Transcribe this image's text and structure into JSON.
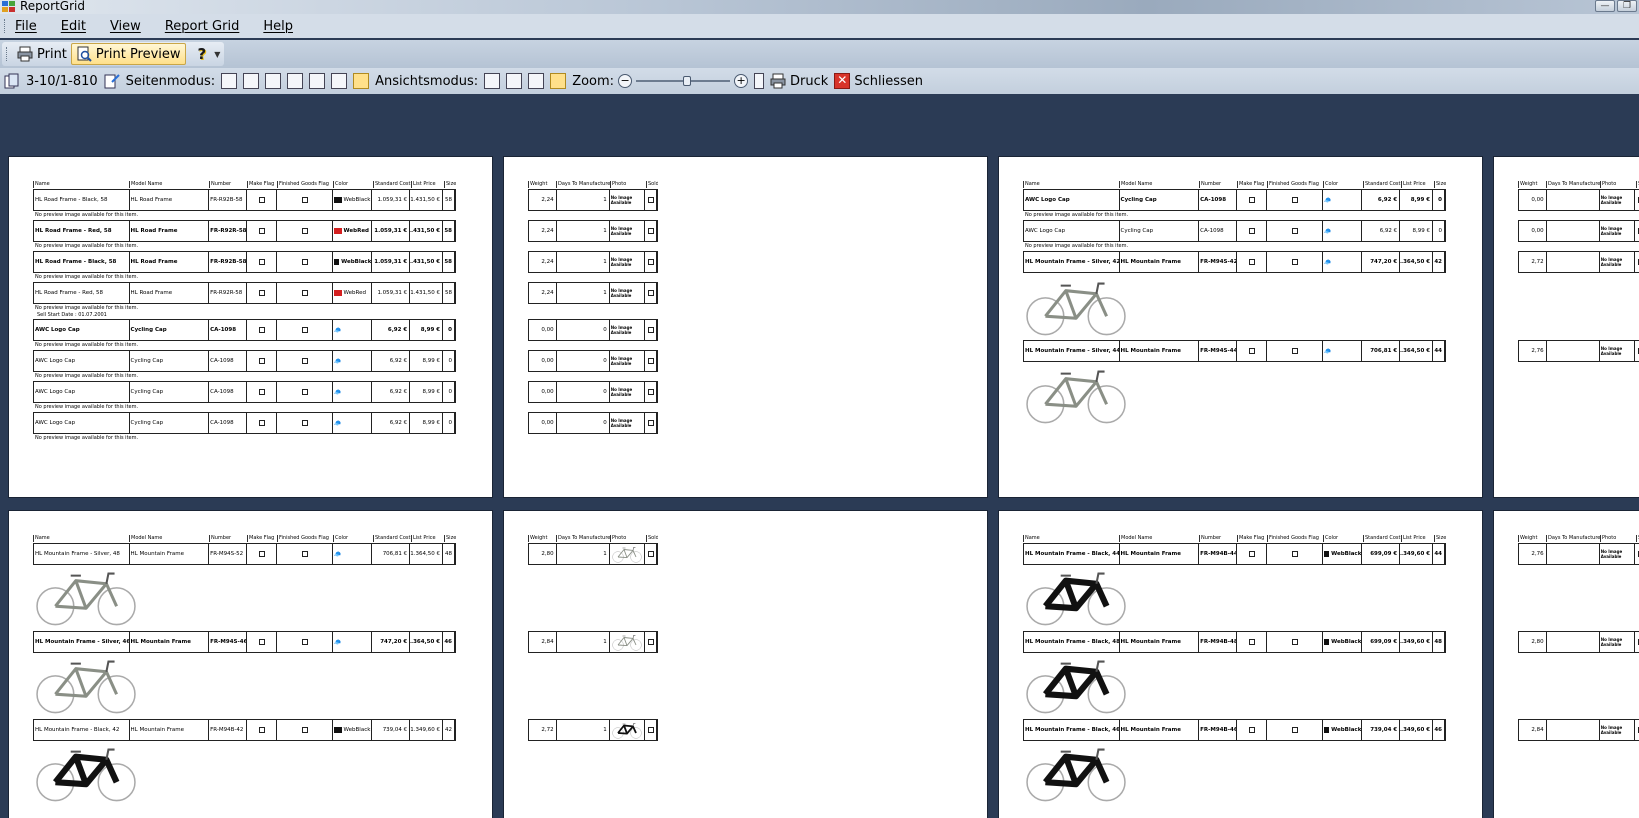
{
  "window": {
    "title": "ReportGrid",
    "minimize": "—",
    "maximize": "❐"
  },
  "menu": [
    "File",
    "Edit",
    "View",
    "Report Grid",
    "Help"
  ],
  "toolbar1": {
    "print": "Print",
    "print_preview": "Print Preview",
    "help_icon": "?"
  },
  "toolbar2": {
    "page_range": "3-10/1-810",
    "page_mode_label": "Seitenmodus:",
    "view_mode_label": "Ansichtsmodus:",
    "zoom_label": "Zoom:",
    "zoom_minus": "−",
    "zoom_plus": "+",
    "zoom_level": 0.55,
    "print_label": "Druck",
    "close_label": "Schliessen"
  },
  "report": {
    "headers_main": [
      "Name",
      "Model Name",
      "Number",
      "Make Flag",
      "Finished Goods Flag",
      "Color",
      "Standard Cost",
      "List Price",
      "Size"
    ],
    "headers_side": [
      "Weight",
      "Days To Manufacture",
      "Photo",
      "Sold"
    ],
    "no_preview": "No preview image available for this item.",
    "sell_start": "Sell Start Date : 01.07.2001",
    "no_image": "No Image Available",
    "page1_rows": [
      [
        "HL Road Frame - Black, 58",
        "HL Road Frame",
        "FR-R92B-58",
        "WebBlack",
        "1.059,31 €",
        "1.431,50 €",
        "58"
      ],
      [
        "HL Road Frame - Red, 58",
        "HL Road Frame",
        "FR-R92R-58",
        "WebRed",
        "1.059,31 €",
        "1.431,50 €",
        "58"
      ],
      [
        "HL Road Frame - Black, 58",
        "HL Road Frame",
        "FR-R92B-58",
        "WebBlack",
        "1.059,31 €",
        "1.431,50 €",
        "58"
      ],
      [
        "HL Road Frame - Red, 58",
        "HL Road Frame",
        "FR-R92R-58",
        "WebRed",
        "1.059,31 €",
        "1.431,50 €",
        "58"
      ],
      [
        "AWC Logo Cap",
        "Cycling Cap",
        "CA-1098",
        "",
        "6,92 €",
        "8,99 €",
        "0"
      ],
      [
        "AWC Logo Cap",
        "Cycling Cap",
        "CA-1098",
        "",
        "6,92 €",
        "8,99 €",
        "0"
      ],
      [
        "AWC Logo Cap",
        "Cycling Cap",
        "CA-1098",
        "",
        "6,92 €",
        "8,99 €",
        "0"
      ],
      [
        "AWC Logo Cap",
        "Cycling Cap",
        "CA-1098",
        "",
        "6,92 €",
        "8,99 €",
        "0"
      ]
    ],
    "page2_rows": [
      [
        "2,24",
        "1"
      ],
      [
        "2,24",
        "1"
      ],
      [
        "2,24",
        "1"
      ],
      [
        "2,24",
        "1"
      ],
      [
        "0,00",
        "0"
      ],
      [
        "0,00",
        "0"
      ],
      [
        "0,00",
        "0"
      ],
      [
        "0,00",
        "0"
      ]
    ],
    "page3_rows": [
      [
        "AWC Logo Cap",
        "Cycling Cap",
        "CA-1098",
        "",
        "6,92 €",
        "8,99 €",
        "0"
      ],
      [
        "AWC Logo Cap",
        "Cycling Cap",
        "CA-1098",
        "",
        "6,92 €",
        "8,99 €",
        "0"
      ],
      [
        "HL Mountain Frame - Silver, 42",
        "HL Mountain Frame",
        "FR-M94S-42",
        "",
        "747,20 €",
        "1.364,50 €",
        "42"
      ],
      [
        "HL Mountain Frame - Silver, 44",
        "HL Mountain Frame",
        "FR-M94S-44",
        "",
        "706,81 €",
        "1.364,50 €",
        "44"
      ]
    ],
    "page4_weights": [
      "0,00",
      "0,00",
      "2,72",
      "2,76"
    ],
    "page5_rows": [
      [
        "HL Mountain Frame - Silver, 48",
        "HL Mountain Frame",
        "FR-M94S-52",
        "",
        "706,81 €",
        "1.364,50 €",
        "48"
      ],
      [
        "HL Mountain Frame - Silver, 46",
        "HL Mountain Frame",
        "FR-M94S-46",
        "",
        "747,20 €",
        "1.364,50 €",
        "46"
      ],
      [
        "HL Mountain Frame - Black, 42",
        "HL Mountain Frame",
        "FR-M94B-42",
        "WebBlack",
        "739,04 €",
        "1.349,60 €",
        "42"
      ]
    ],
    "page6_rows": [
      [
        "2,80",
        "1"
      ],
      [
        "2,84",
        "1"
      ],
      [
        "2,72",
        "1"
      ]
    ],
    "page7_rows": [
      [
        "HL Mountain Frame - Black, 44",
        "HL Mountain Frame",
        "FR-M94B-44",
        "WebBlack",
        "699,09 €",
        "1.349,60 €",
        "44"
      ],
      [
        "HL Mountain Frame - Black, 48",
        "HL Mountain Frame",
        "FR-M94B-48",
        "WebBlack",
        "699,09 €",
        "1.349,60 €",
        "48"
      ],
      [
        "HL Mountain Frame - Black, 46",
        "HL Mountain Frame",
        "FR-M94B-46",
        "WebBlack",
        "739,04 €",
        "1.349,60 €",
        "46"
      ]
    ],
    "page8_weights": [
      "2,76",
      "2,80",
      "2,84"
    ]
  },
  "colors": {
    "web_red": "#d42020",
    "web_black": "#111111",
    "accent": "#ffe08a"
  }
}
